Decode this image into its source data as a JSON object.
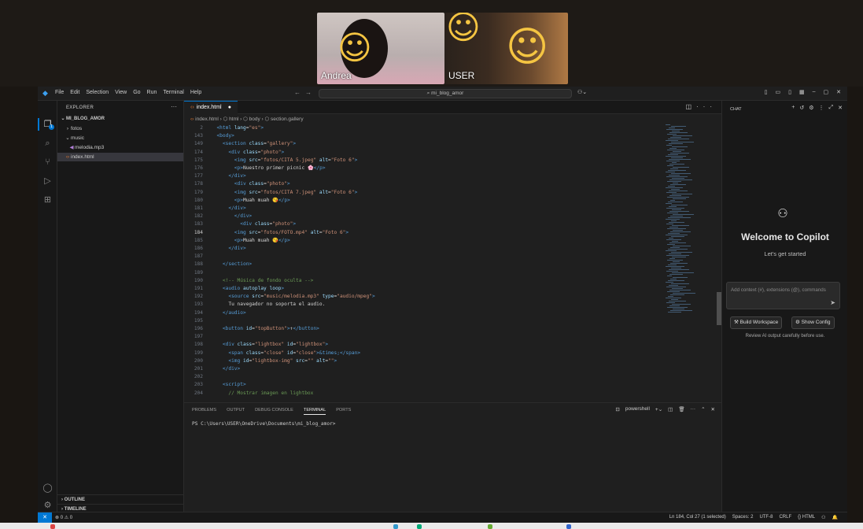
{
  "video": {
    "participants": [
      {
        "name": "Andrea",
        "emoji": "☺"
      },
      {
        "name": "USER",
        "emoji": "☺"
      }
    ]
  },
  "window": {
    "menu": [
      "File",
      "Edit",
      "Selection",
      "View",
      "Go",
      "Run",
      "Terminal",
      "Help"
    ],
    "search_text": "mi_blog_amor",
    "accent": "#0078d4"
  },
  "explorer": {
    "title": "EXPLORER",
    "project": "MI_BLOG_AMOR",
    "items": [
      {
        "label": "fotos",
        "type": "folder-collapsed"
      },
      {
        "label": "music",
        "type": "folder-open"
      },
      {
        "label": "melodia.mp3",
        "type": "audio-file"
      },
      {
        "label": "index.html",
        "type": "html-file"
      }
    ],
    "outline": "OUTLINE",
    "timeline": "TIMELINE"
  },
  "editor": {
    "tab": "index.html",
    "breadcrumb": [
      "index.html",
      "html",
      "body",
      "section.gallery"
    ],
    "lines": [
      {
        "n": "2",
        "code": [
          [
            "tag",
            "  <html "
          ],
          [
            "attr",
            "lang"
          ],
          [
            "txt",
            "="
          ],
          [
            "str",
            "\"es\""
          ],
          [
            "tag",
            ">"
          ]
        ]
      },
      {
        "n": "143",
        "code": [
          [
            "tag",
            "  <body>"
          ]
        ]
      },
      {
        "n": "149",
        "code": [
          [
            "tag",
            "    <section "
          ],
          [
            "attr",
            "class"
          ],
          [
            "txt",
            "="
          ],
          [
            "str",
            "\"gallery\""
          ],
          [
            "tag",
            ">"
          ]
        ]
      },
      {
        "n": "174",
        "code": [
          [
            "tag",
            "      <div "
          ],
          [
            "attr",
            "class"
          ],
          [
            "txt",
            "="
          ],
          [
            "str",
            "\"photo\""
          ],
          [
            "tag",
            ">"
          ]
        ]
      },
      {
        "n": "175",
        "code": [
          [
            "tag",
            "        <img "
          ],
          [
            "attr",
            "src"
          ],
          [
            "txt",
            "="
          ],
          [
            "str",
            "\"fotos/CITA 5.jpeg\""
          ],
          [
            "attr",
            " alt"
          ],
          [
            "txt",
            "="
          ],
          [
            "str",
            "\"Foto 6\""
          ],
          [
            "tag",
            ">"
          ]
        ]
      },
      {
        "n": "176",
        "code": [
          [
            "tag",
            "        <p>"
          ],
          [
            "txt",
            "Nuestro primer picnic 🌸"
          ],
          [
            "tag",
            "</p>"
          ]
        ]
      },
      {
        "n": "177",
        "code": [
          [
            "tag",
            "      </div>"
          ]
        ]
      },
      {
        "n": "178",
        "code": [
          [
            "tag",
            "        <div "
          ],
          [
            "attr",
            "class"
          ],
          [
            "txt",
            "="
          ],
          [
            "str",
            "\"photo\""
          ],
          [
            "tag",
            ">"
          ]
        ]
      },
      {
        "n": "179",
        "code": [
          [
            "tag",
            "        <img "
          ],
          [
            "attr",
            "src"
          ],
          [
            "txt",
            "="
          ],
          [
            "str",
            "\"fotos/CITA 7.jpeg\""
          ],
          [
            "attr",
            " alt"
          ],
          [
            "txt",
            "="
          ],
          [
            "str",
            "\"Foto 6\""
          ],
          [
            "tag",
            ">"
          ]
        ]
      },
      {
        "n": "180",
        "code": [
          [
            "tag",
            "        <p>"
          ],
          [
            "txt",
            "Muah muah 😘"
          ],
          [
            "tag",
            "</p>"
          ]
        ]
      },
      {
        "n": "181",
        "code": [
          [
            "tag",
            "      </div>"
          ]
        ]
      },
      {
        "n": "182",
        "code": [
          [
            "tag",
            "        </div>"
          ]
        ]
      },
      {
        "n": "183",
        "code": [
          [
            "tag",
            "          <div "
          ],
          [
            "attr",
            "class"
          ],
          [
            "txt",
            "="
          ],
          [
            "str",
            "\"photo\""
          ],
          [
            "tag",
            ">"
          ]
        ]
      },
      {
        "n": "184",
        "cur": true,
        "code": [
          [
            "tag",
            "        <img "
          ],
          [
            "attr",
            "src"
          ],
          [
            "txt",
            "="
          ],
          [
            "str",
            "\"fotos/FOTO.mp4\""
          ],
          [
            "attr",
            " alt"
          ],
          [
            "txt",
            "="
          ],
          [
            "str",
            "\"Foto 6\""
          ],
          [
            "tag",
            ">"
          ]
        ]
      },
      {
        "n": "185",
        "code": [
          [
            "tag",
            "        <p>"
          ],
          [
            "txt",
            "Muah muah 😘"
          ],
          [
            "tag",
            "</p>"
          ]
        ]
      },
      {
        "n": "186",
        "code": [
          [
            "tag",
            "      </div>"
          ]
        ]
      },
      {
        "n": "187",
        "code": [
          [
            "txt",
            ""
          ]
        ]
      },
      {
        "n": "188",
        "code": [
          [
            "tag",
            "    </section>"
          ]
        ]
      },
      {
        "n": "189",
        "code": [
          [
            "txt",
            ""
          ]
        ]
      },
      {
        "n": "190",
        "code": [
          [
            "com",
            "    <!-- Música de fondo oculta -->"
          ]
        ]
      },
      {
        "n": "191",
        "code": [
          [
            "tag",
            "    <audio "
          ],
          [
            "attr",
            "autoplay loop"
          ],
          [
            "tag",
            ">"
          ]
        ]
      },
      {
        "n": "192",
        "code": [
          [
            "tag",
            "      <source "
          ],
          [
            "attr",
            "src"
          ],
          [
            "txt",
            "="
          ],
          [
            "str",
            "\"music/melodia.mp3\""
          ],
          [
            "attr",
            " type"
          ],
          [
            "txt",
            "="
          ],
          [
            "str",
            "\"audio/mpeg\""
          ],
          [
            "tag",
            ">"
          ]
        ]
      },
      {
        "n": "193",
        "code": [
          [
            "txt",
            "      Tu navegador no soporta el audio."
          ]
        ]
      },
      {
        "n": "194",
        "code": [
          [
            "tag",
            "    </audio>"
          ]
        ]
      },
      {
        "n": "195",
        "code": [
          [
            "txt",
            ""
          ]
        ]
      },
      {
        "n": "196",
        "code": [
          [
            "tag",
            "    <button "
          ],
          [
            "attr",
            "id"
          ],
          [
            "txt",
            "="
          ],
          [
            "str",
            "\"topButton\""
          ],
          [
            "tag",
            ">"
          ],
          [
            "txt",
            "↑"
          ],
          [
            "tag",
            "</button>"
          ]
        ]
      },
      {
        "n": "197",
        "code": [
          [
            "txt",
            ""
          ]
        ]
      },
      {
        "n": "198",
        "code": [
          [
            "tag",
            "    <div "
          ],
          [
            "attr",
            "class"
          ],
          [
            "txt",
            "="
          ],
          [
            "str",
            "\"lightbox\""
          ],
          [
            "attr",
            " id"
          ],
          [
            "txt",
            "="
          ],
          [
            "str",
            "\"lightbox\""
          ],
          [
            "tag",
            ">"
          ]
        ]
      },
      {
        "n": "199",
        "code": [
          [
            "tag",
            "      <span "
          ],
          [
            "attr",
            "class"
          ],
          [
            "txt",
            "="
          ],
          [
            "str",
            "\"close\""
          ],
          [
            "attr",
            " id"
          ],
          [
            "txt",
            "="
          ],
          [
            "str",
            "\"close\""
          ],
          [
            "tag",
            ">"
          ],
          [
            "ent",
            "&times;"
          ],
          [
            "tag",
            "</span>"
          ]
        ]
      },
      {
        "n": "200",
        "code": [
          [
            "tag",
            "      <img "
          ],
          [
            "attr",
            "id"
          ],
          [
            "txt",
            "="
          ],
          [
            "str",
            "\"lightbox-img\""
          ],
          [
            "attr",
            " src"
          ],
          [
            "txt",
            "="
          ],
          [
            "str",
            "\"\""
          ],
          [
            "attr",
            " alt"
          ],
          [
            "txt",
            "="
          ],
          [
            "str",
            "\"\""
          ],
          [
            "tag",
            ">"
          ]
        ]
      },
      {
        "n": "201",
        "code": [
          [
            "tag",
            "    </div>"
          ]
        ]
      },
      {
        "n": "202",
        "code": [
          [
            "txt",
            ""
          ]
        ]
      },
      {
        "n": "203",
        "code": [
          [
            "tag",
            "    <script>"
          ]
        ]
      },
      {
        "n": "204",
        "code": [
          [
            "com",
            "      // Mostrar imagen en lightbox"
          ]
        ]
      }
    ]
  },
  "panel": {
    "tabs": [
      "PROBLEMS",
      "OUTPUT",
      "DEBUG CONSOLE",
      "TERMINAL",
      "PORTS"
    ],
    "active_tab": "TERMINAL",
    "shell": "powershell",
    "prompt": "PS C:\\Users\\USER\\OneDrive\\Documents\\mi_blog_amor>"
  },
  "chat": {
    "header": "CHAT",
    "welcome": "Welcome to Copilot",
    "subtitle": "Let's get started",
    "input_placeholder": "Add context (#), extensions (@), commands",
    "build_button": "Build Workspace",
    "config_button": "Show Config",
    "review_note": "Review AI output carefully before use."
  },
  "status": {
    "errors": "⊗ 0 ⚠ 0",
    "position": "Ln 184, Col 27 (1 selected)",
    "spaces": "Spaces: 2",
    "encoding": "UTF-8",
    "eol": "CRLF",
    "language": "{} HTML"
  }
}
